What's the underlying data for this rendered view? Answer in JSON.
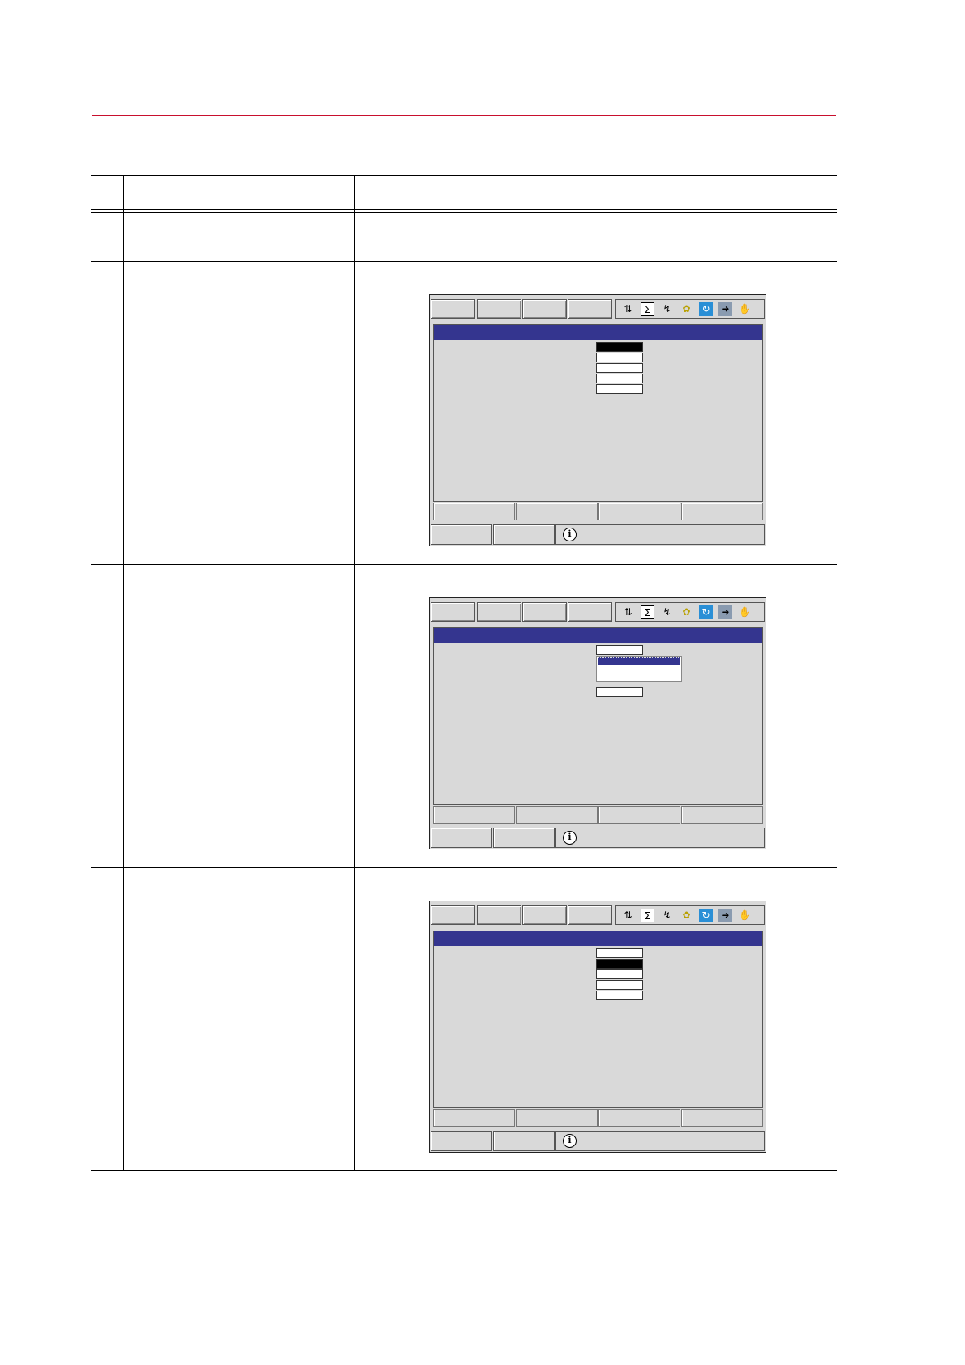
{
  "colors": {
    "header_rule": "#c8102e",
    "screen_title_bar": "#34358f",
    "screen_background": "#d9d9d9",
    "selected_field": "#000000"
  },
  "table": {
    "header": {
      "no": "",
      "operation": "",
      "explanation": ""
    },
    "rows": [
      {
        "no": "",
        "operation": "",
        "explanation": ""
      },
      {
        "no": "",
        "operation": "",
        "explanation": "",
        "screen": "selected-first-field"
      },
      {
        "no": "",
        "operation": "",
        "explanation": "",
        "screen": "dropdown-open"
      },
      {
        "no": "",
        "operation": "",
        "explanation": "",
        "screen": "selected-second-field"
      }
    ]
  },
  "screen_icons": [
    "sort-icon",
    "sigma-icon",
    "robot-arm-icon",
    "tool-icon",
    "cycle-icon",
    "page-icon",
    "hand-icon"
  ],
  "info_icon": "info-icon"
}
